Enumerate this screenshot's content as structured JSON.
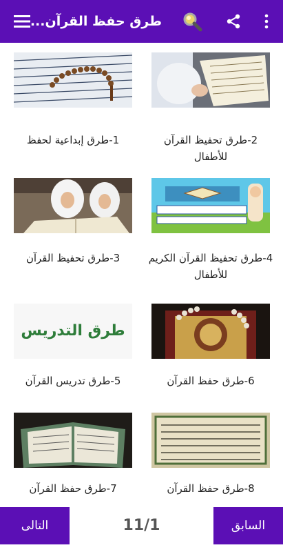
{
  "app_bar": {
    "title": "طرق حفظ القرآن...",
    "background": "#5b0fb5",
    "icons": [
      "more-vertical-icon",
      "share-icon",
      "search-icon",
      "menu-icon"
    ]
  },
  "items": [
    {
      "label": "2-طرق تحفيظ القرآن للأطفال",
      "image": "quran-child-reading"
    },
    {
      "label": "1-طرق إبداعية لحفظ",
      "image": "quran-prayer-beads"
    },
    {
      "label": "4-طرق تحفيظ القرآن الكريم للأطفال",
      "image": "quran-cartoon-illustration"
    },
    {
      "label": "3-طرق تحفيظ القرآن",
      "image": "girls-reading-quran"
    },
    {
      "label": "6-طرق حفظ القرآن",
      "image": "quran-gold-cover-beads"
    },
    {
      "label": "5-طرق تدريس القرآن",
      "image": "teaching-methods-calligraphy"
    },
    {
      "label": "8-طرق حفظ القرآن",
      "image": "quran-page-closeup"
    },
    {
      "label": "7-طرق حفظ القرآن",
      "image": "open-quran-book"
    }
  ],
  "thumb_text": {
    "teaching": "طرق التدريس"
  },
  "pagination": {
    "previous_label": "السابق",
    "next_label": "التالى",
    "page_indicator": "11/1"
  }
}
